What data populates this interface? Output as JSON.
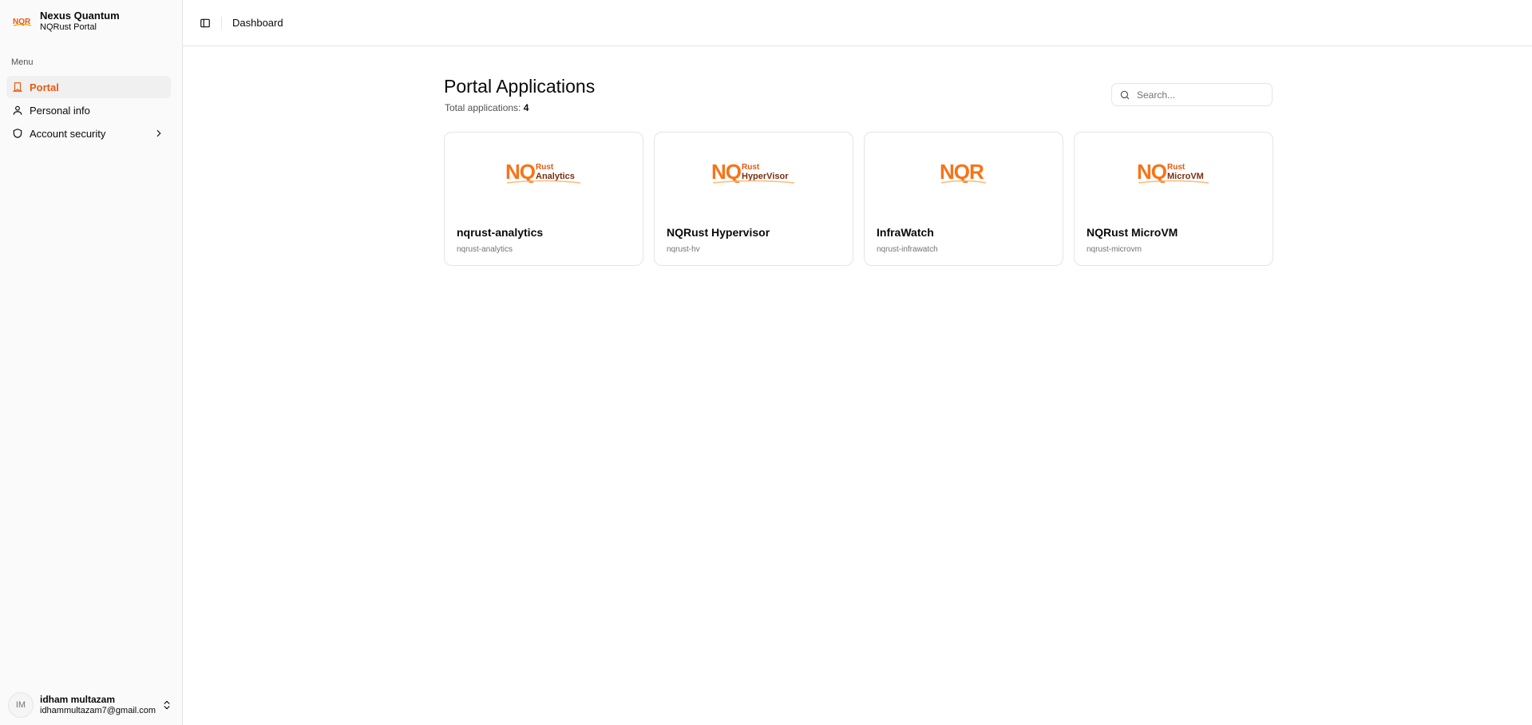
{
  "brand": {
    "title": "Nexus Quantum",
    "subtitle": "NQRust Portal",
    "logo_text": "NQR",
    "accent": "#ea580c"
  },
  "sidebar": {
    "menu_label": "Menu",
    "items": [
      {
        "label": "Portal",
        "icon": "bookmark-icon",
        "active": true
      },
      {
        "label": "Personal info",
        "icon": "user-icon"
      },
      {
        "label": "Account security",
        "icon": "shield-icon",
        "has_submenu": true
      }
    ]
  },
  "user": {
    "initials": "IM",
    "name": "idham multazam",
    "email": "idhammultazam7@gmail.com"
  },
  "header": {
    "breadcrumb": "Dashboard"
  },
  "main": {
    "title": "Portal Applications",
    "total_label": "Total applications:",
    "total_count": "4",
    "search_placeholder": "Search..."
  },
  "apps": [
    {
      "name": "nqrust-analytics",
      "slug": "nqrust-analytics",
      "logo_top": "Rust",
      "logo_bottom": "Analytics"
    },
    {
      "name": "NQRust Hypervisor",
      "slug": "nqrust-hv",
      "logo_top": "Rust",
      "logo_bottom": "HyperVisor"
    },
    {
      "name": "InfraWatch",
      "slug": "nqrust-infrawatch",
      "logo_main": "NQR"
    },
    {
      "name": "NQRust MicroVM",
      "slug": "nqrust-microvm",
      "logo_top": "Rust",
      "logo_bottom": "MicroVM"
    }
  ]
}
